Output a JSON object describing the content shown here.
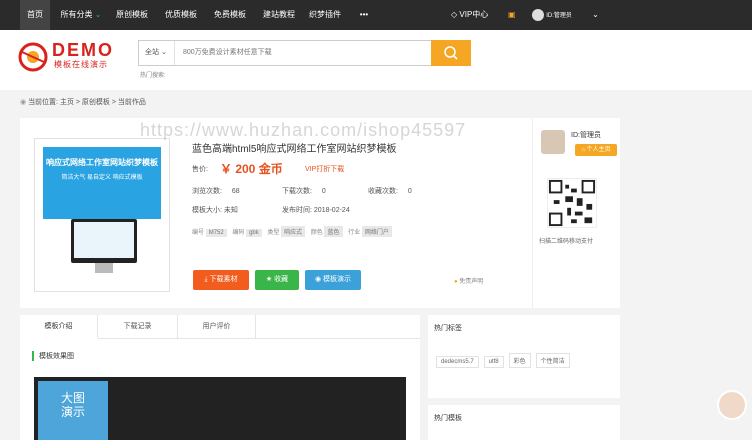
{
  "topbar": {
    "home": "首页",
    "all_categories": "所有分类",
    "nav": [
      "原创模板",
      "优质模板",
      "免费模板",
      "建站教程",
      "织梦插件",
      "•••"
    ],
    "vip_center": "VIP中心",
    "user_id": "ID:管理员"
  },
  "header": {
    "logo_text": "DEMO",
    "logo_sub": "模板在线演示",
    "search_scope": "全站",
    "search_placeholder": "800万免费设计素材任意下载",
    "hot_search_label": "热门搜索:"
  },
  "breadcrumb": "当前位置: 主页 > 原创模板 > 当前作品",
  "product": {
    "title": "蓝色高端html5响应式网络工作室网站织梦模板",
    "price_label": "售价:",
    "price": "￥ 200 金币",
    "vip_label": "VIP打折下载",
    "views_label": "浏览次数:",
    "views": "68",
    "downloads_label": "下载次数:",
    "downloads": "0",
    "favorites_label": "收藏次数:",
    "favorites": "0",
    "size_label": "模板大小:",
    "size": "未知",
    "date_label": "发布时间:",
    "date": "2018-02-24",
    "tags": [
      {
        "k": "编号",
        "v": "M752"
      },
      {
        "k": "编码",
        "v": "gbk"
      },
      {
        "k": "类型",
        "v": "响应式"
      },
      {
        "k": "颜色",
        "v": "蓝色"
      },
      {
        "k": "行业",
        "v": "网络门户"
      }
    ],
    "thumb_title": "响应式网络工作室网站织梦模板",
    "thumb_sub": "简洁大气 易自定义 响应式模板",
    "download_btn": "下载素材",
    "fav_btn": "收藏",
    "demo_btn": "模板演示",
    "disclaimer": "免责声明"
  },
  "author": {
    "name": "ID:管理员",
    "homepage_btn": "个人主页",
    "qr_caption": "扫描二维码移动支付"
  },
  "watermark": "https://www.huzhan.com/ishop45597",
  "tabs": [
    "模板介绍",
    "下载记录",
    "用户评价"
  ],
  "preview_section": "模板效果图",
  "preview_badge_line1": "大图",
  "preview_badge_line2": "演示",
  "hot_tags": {
    "title": "热门标签",
    "items": [
      "dedecms5.7",
      "utf8",
      "彩色",
      "个性简洁"
    ]
  },
  "hot_templates_title": "热门模板",
  "colors": {
    "topbar": "#2b2b2b",
    "accent": "#f5a623",
    "price": "#e8501e",
    "brand": "#d8221c"
  }
}
